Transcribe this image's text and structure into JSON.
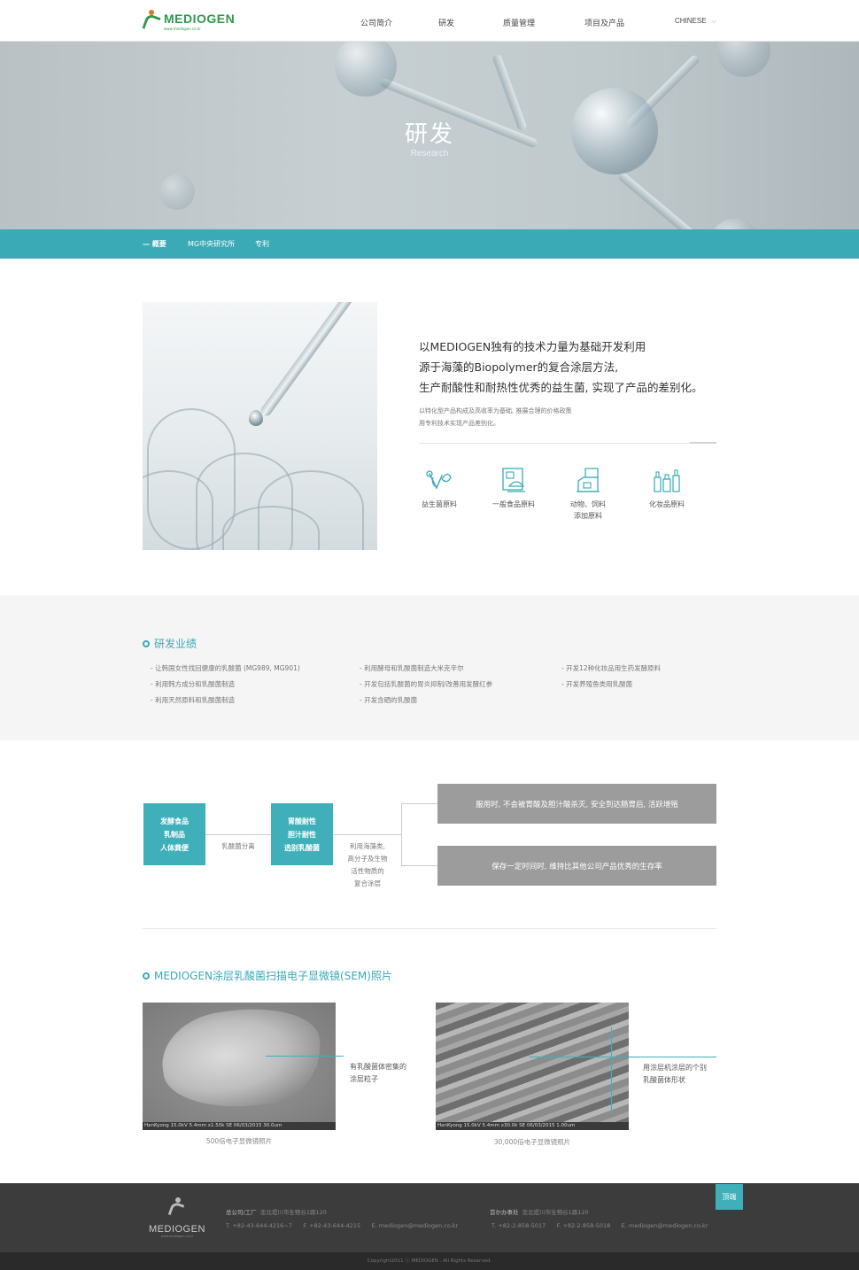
{
  "header": {
    "logo_name": "MEDIOGEN",
    "logo_tagline": "www.mediogen.co.kr",
    "nav": [
      "公司简介",
      "研发",
      "质量管理",
      "项目及产品"
    ],
    "language": "CHINESE"
  },
  "hero": {
    "title": "研发",
    "subtitle": "Research"
  },
  "subnav": {
    "items": [
      "— 概要",
      "MG中央研究所",
      "专利"
    ]
  },
  "intro": {
    "headline": [
      "以MEDIOGEN独有的技术力量为基础开发利用",
      "源于海藻的Biopolymer的复合涂层方法,",
      "生产耐酸性和耐热性优秀的益生菌, 实现了产品的差别化。"
    ],
    "sub": [
      "以特化型产品构成及高收率为基础, 推展合理的价格政策",
      "用专利技术实现产品差别化。"
    ],
    "categories": [
      {
        "icon": "probiotic-icon",
        "label": "益生菌原料"
      },
      {
        "icon": "food-icon",
        "label": "一般食品原料"
      },
      {
        "icon": "feed-icon",
        "label": "动物、饲料\n添加原料"
      },
      {
        "icon": "cosmetic-icon",
        "label": "化妆品原料"
      }
    ]
  },
  "achievements": {
    "title": "研发业绩",
    "columns": [
      [
        "- 让韩国女性找回健康的乳酸菌 (MG989, MG901)",
        "- 利用韩方成分和乳酸菌制造",
        "- 利用天然原料和乳酸菌制造"
      ],
      [
        "- 利用酵母和乳酸菌制造大米克辛尔",
        "- 开发包括乳酸菌的胃炎抑制/改善用发酵红参",
        "- 开发含硒的乳酸菌"
      ],
      [
        "- 开发12种化妆品用生药发酵原料",
        "- 开发养殖鱼类用乳酸菌"
      ]
    ]
  },
  "process": {
    "box1": [
      "发酵食品",
      "乳制品",
      "人体粪便"
    ],
    "step1": "乳酸菌分离",
    "box2": [
      "胃酸耐性",
      "胆汁耐性",
      "选别乳酸菌"
    ],
    "step2": [
      "利用海藻类,",
      "高分子及生物",
      "活性物质的",
      "复合涂层"
    ],
    "result1": "服用时, 不会被胃酸及胆汁酸杀灭, 安全到达肠胃后, 活跃增殖",
    "result2": "保存一定时间时, 维持比其他公司产品优秀的生存率"
  },
  "sem": {
    "title": "MEDIOGEN涂层乳酸菌扫描电子显微镜(SEM)照片",
    "photo1": {
      "bar": "HanKyong 15.0kV 5.4mm x1.50k SE 06/03/2015                30.0um",
      "caption": "500倍电子显微镜照片",
      "note": [
        "有乳酸菌体密集的",
        "涂层粒子"
      ]
    },
    "photo2": {
      "bar": "HanKyong 15.0kV 5.4mm x30.0k SE 06/03/2015                1.00um",
      "caption": "30,000倍电子显微镜照片",
      "note": [
        "用涂层机涂层的个别",
        "乳酸菌体形状"
      ]
    }
  },
  "footer": {
    "logo_name": "MEDIOGEN",
    "logo_tagline": "www.mediogen.co.kr",
    "hq_label": "总公司/工厂",
    "hq_address": "忠北堤川市生物谷1路120",
    "hq_tel": "T. +82-43-644-4216~7",
    "hq_fax": "F. +82-43-644-4215",
    "hq_email": "E. mediogen@mediogen.co.kr",
    "seoul_label": "首尔办事处",
    "seoul_address": "忠北堤川市生物谷1路120",
    "seoul_tel": "T. +82-2-858-5017",
    "seoul_fax": "F. +82-2-858-5018",
    "seoul_email": "E. mediogen@mediogen.co.kr",
    "to_top": "顶端",
    "copyright": "Copyright2011 ⓒ MEDIOGEN . All Rights Reserved."
  },
  "colors": {
    "accent": "#3aaab6",
    "brand": "#2e9a4a",
    "gray_box": "#9c9c9c",
    "footer": "#3c3c3c"
  }
}
